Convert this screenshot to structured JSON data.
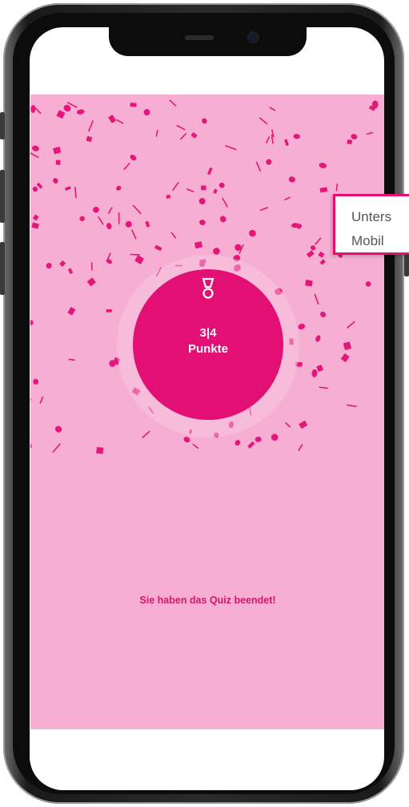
{
  "score": {
    "value": "3|4",
    "unit_label": "Punkte",
    "icon": "medal-icon"
  },
  "finish_message": "Sie haben das Quiz beendet!",
  "tooltip": {
    "line1": "Unters",
    "line2": "Mobil"
  },
  "colors": {
    "background": "#f6afd3",
    "accent": "#e20f74",
    "confetti": "#e4167a"
  }
}
